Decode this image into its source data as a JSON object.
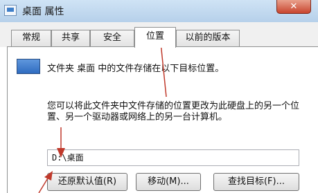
{
  "window": {
    "title": "桌面 属性",
    "close_label": "✕"
  },
  "tabs": [
    {
      "label": "常规",
      "active": false
    },
    {
      "label": "共享",
      "active": false
    },
    {
      "label": "安全",
      "active": false
    },
    {
      "label": "位置",
      "active": true
    },
    {
      "label": "以前的版本",
      "active": false
    }
  ],
  "location": {
    "info": "文件夹 桌面 中的文件存储在以下目标位置。",
    "description": "您可以将此文件夹中文件存储的位置更改为此硬盘上的另一个位置、另一个驱动器或网络上的另一台计算机。",
    "path_value": "D:\\桌面"
  },
  "buttons": {
    "restore": "还原默认值(R)",
    "move": "移动(M)...",
    "find": "查找目标(F)..."
  },
  "colors": {
    "annotation_arrow": "#c0392b",
    "titlebar": "#b6d0ea"
  },
  "icons": {
    "window": "folder-icon",
    "folder": "folder-icon"
  }
}
